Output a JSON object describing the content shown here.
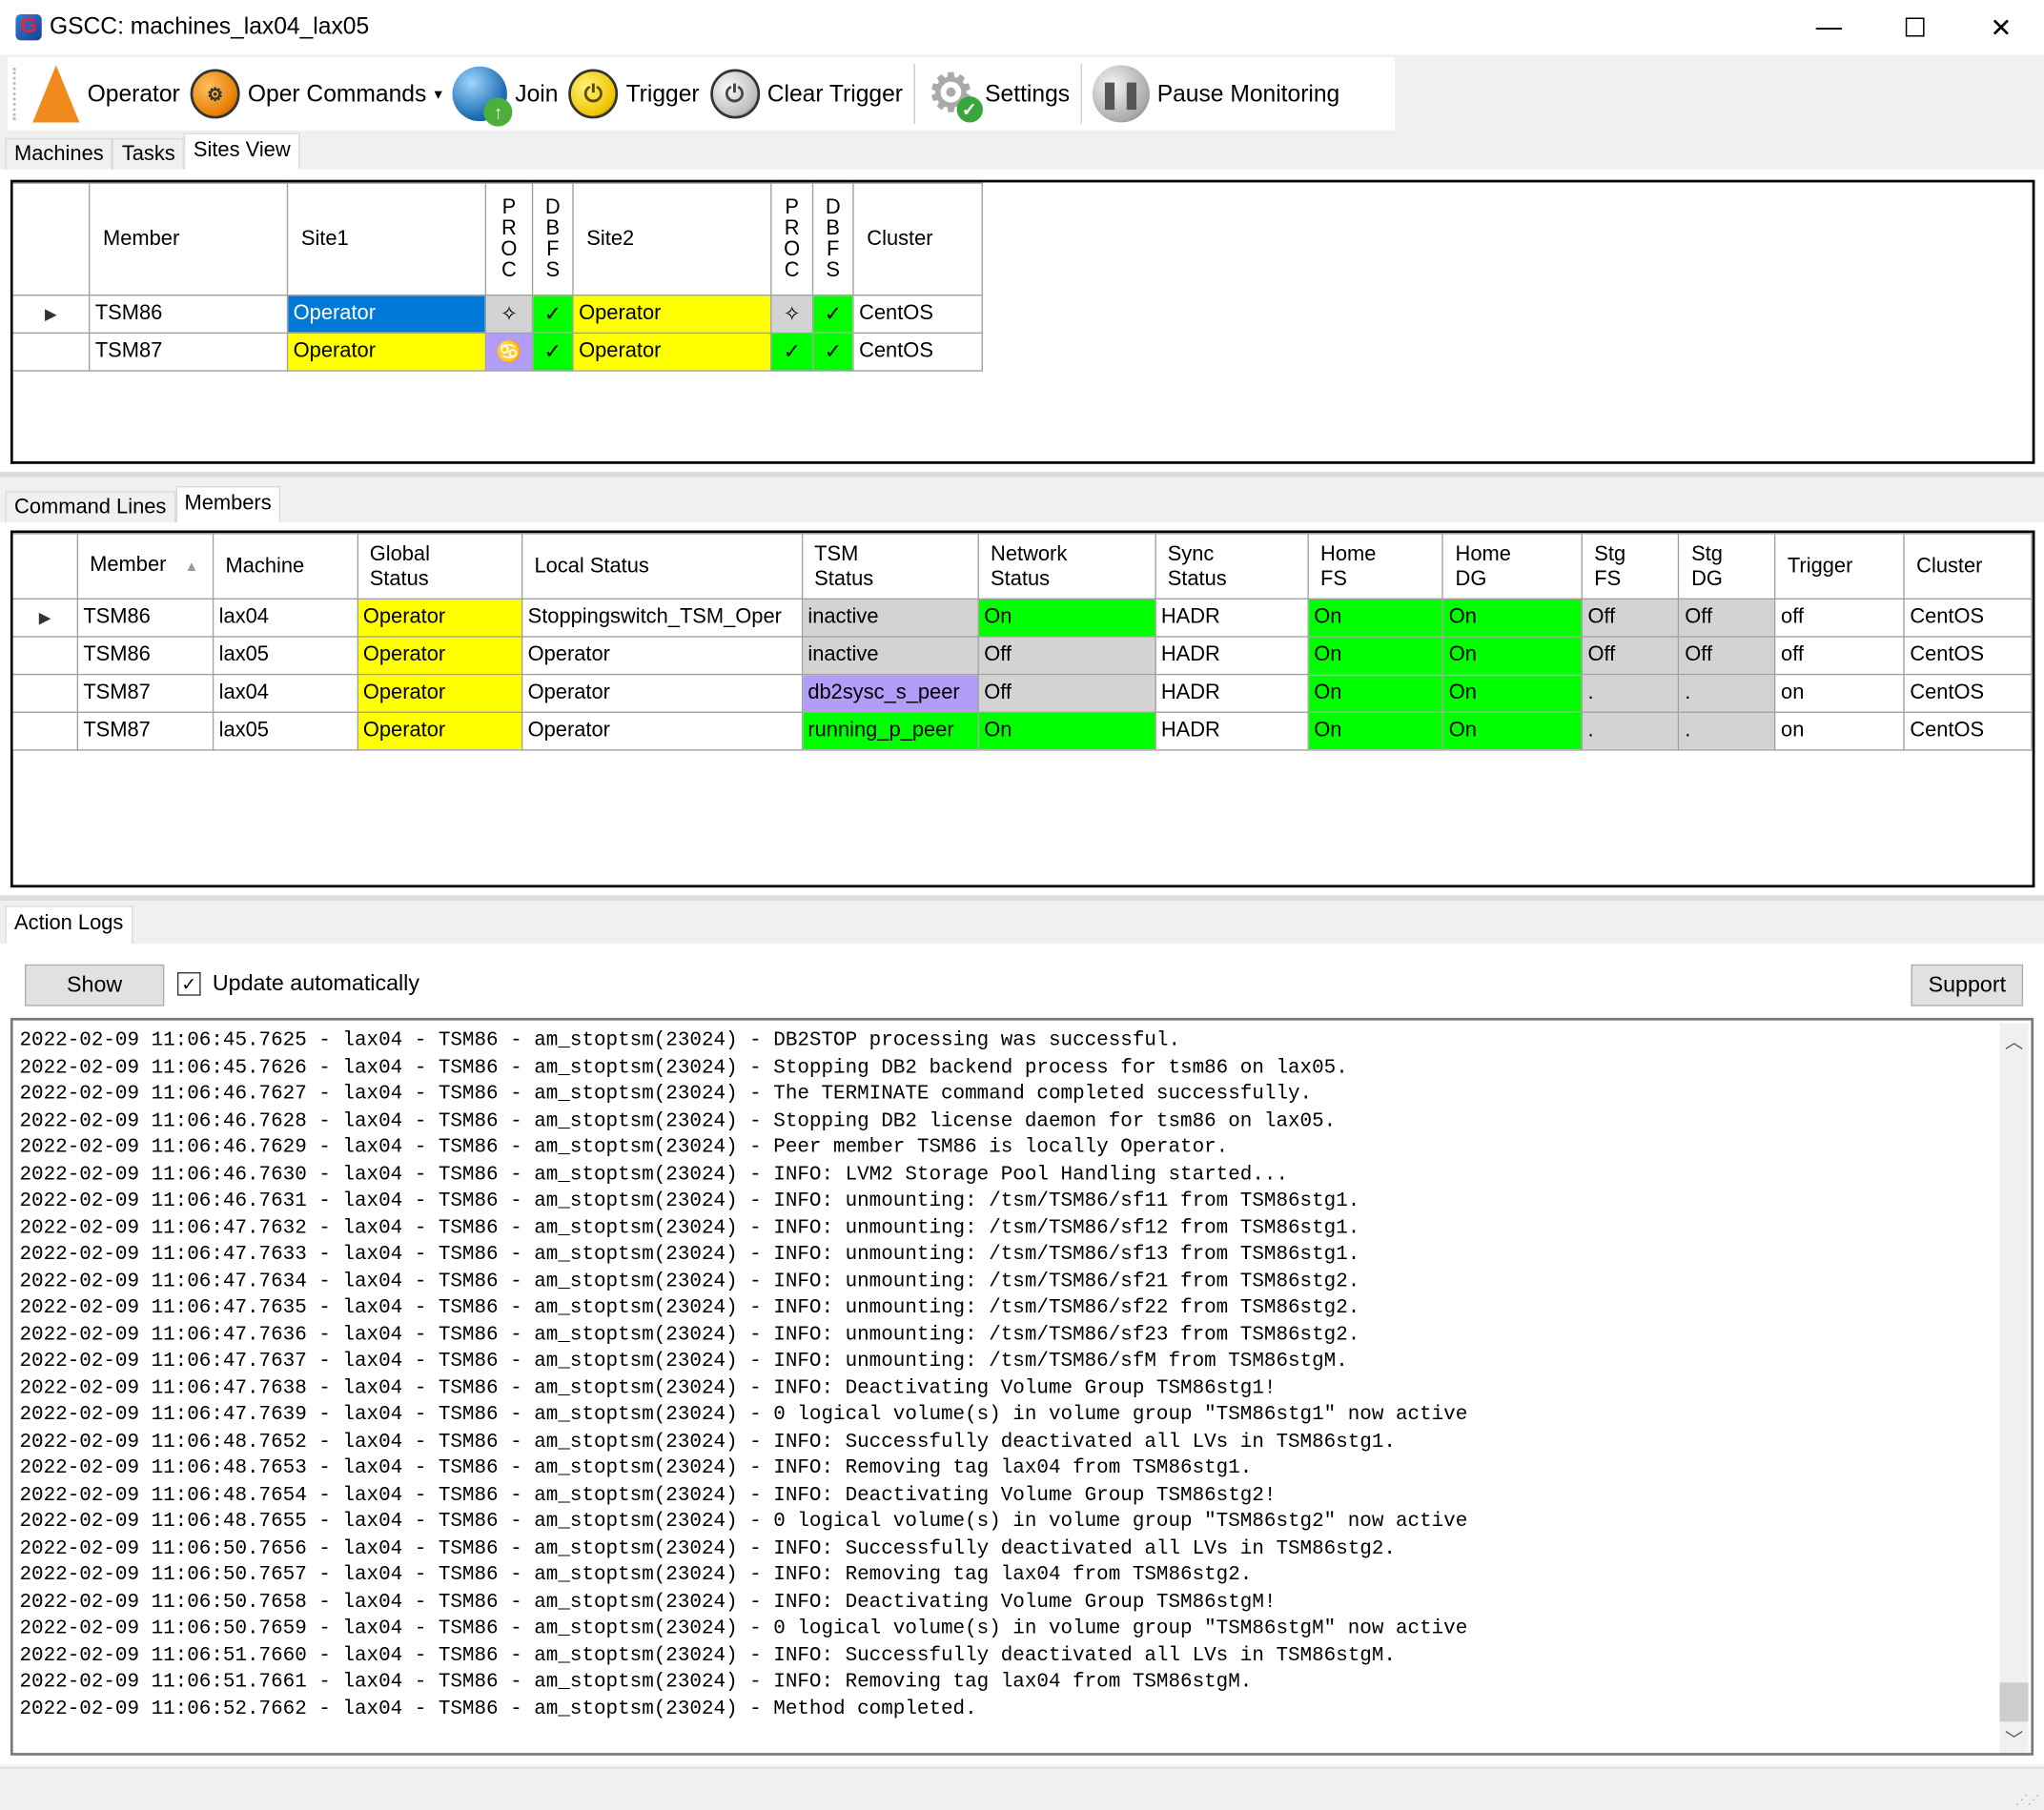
{
  "window": {
    "title": "GSCC: machines_lax04_lax05",
    "app_icon_glyph": "G",
    "controls": {
      "minimize": "—",
      "maximize": "☐",
      "close": "✕"
    }
  },
  "toolbar": {
    "items": [
      {
        "label": "Operator",
        "icon": "traffic-cone-icon"
      },
      {
        "label": "Oper Commands",
        "icon": "gears-icon",
        "has_dropdown": true,
        "dropdown_glyph": "▾",
        "glyph": "⚙"
      },
      {
        "label": "Join",
        "icon": "globe-icon"
      },
      {
        "label": "Trigger",
        "icon": "power-icon",
        "glyph": "⏻"
      },
      {
        "label": "Clear Trigger",
        "icon": "clear-power-icon",
        "glyph": "⏻"
      },
      {
        "label": "Settings",
        "icon": "settings-gear-icon",
        "glyph": "⚙"
      },
      {
        "label": "Pause Monitoring",
        "icon": "pause-icon",
        "glyph": "❚❚"
      }
    ]
  },
  "top_tabs": [
    {
      "label": "Machines",
      "active": false
    },
    {
      "label": "Tasks",
      "active": false
    },
    {
      "label": "Sites View",
      "active": true
    }
  ],
  "sites_table": {
    "columns": [
      "",
      "Member",
      "Site1",
      "PROC",
      "DBFS",
      "Site2",
      "PROC",
      "DBFS",
      "Cluster"
    ],
    "rows": [
      {
        "selected_marker": "▶",
        "member": "TSM86",
        "site1": {
          "text": "Operator",
          "color": "#0078d7"
        },
        "proc1": {
          "glyph": "✧",
          "color": "#d3d3d3"
        },
        "dbfs1": {
          "glyph": "✓",
          "color": "#00ff00"
        },
        "site2": {
          "text": "Operator",
          "color": "#ffff00"
        },
        "proc2": {
          "glyph": "✧",
          "color": "#d3d3d3"
        },
        "dbfs2": {
          "glyph": "✓",
          "color": "#00ff00"
        },
        "cluster": "CentOS"
      },
      {
        "selected_marker": "",
        "member": "TSM87",
        "site1": {
          "text": "Operator",
          "color": "#ffff00"
        },
        "proc1": {
          "glyph": "♋",
          "color": "#b19cf7"
        },
        "dbfs1": {
          "glyph": "✓",
          "color": "#00ff00"
        },
        "site2": {
          "text": "Operator",
          "color": "#ffff00"
        },
        "proc2": {
          "glyph": "✓",
          "color": "#00ff00"
        },
        "dbfs2": {
          "glyph": "✓",
          "color": "#00ff00"
        },
        "cluster": "CentOS"
      }
    ]
  },
  "mid_tabs": [
    {
      "label": "Command Lines",
      "active": false
    },
    {
      "label": "Members",
      "active": true
    }
  ],
  "members_table": {
    "columns": [
      [
        "Member"
      ],
      [
        "Machine"
      ],
      [
        "Global",
        "Status"
      ],
      [
        "Local Status"
      ],
      [
        "TSM",
        "Status"
      ],
      [
        "Network",
        "Status"
      ],
      [
        "Sync",
        "Status"
      ],
      [
        "Home",
        "FS"
      ],
      [
        "Home",
        "DG"
      ],
      [
        "Stg",
        "FS"
      ],
      [
        "Stg",
        "DG"
      ],
      [
        "Trigger"
      ],
      [
        "Cluster"
      ]
    ],
    "sort_indicator": "▲",
    "rows": [
      {
        "marker": "▶",
        "cells": [
          {
            "t": "TSM86",
            "c": "#ffffff"
          },
          {
            "t": "lax04",
            "c": "#ffffff"
          },
          {
            "t": "Operator",
            "c": "#ffff00"
          },
          {
            "t": "Stoppingswitch_TSM_Oper",
            "c": "#ffffff"
          },
          {
            "t": "inactive",
            "c": "#d3d3d3"
          },
          {
            "t": "On",
            "c": "#00ff00"
          },
          {
            "t": "HADR",
            "c": "#ffffff"
          },
          {
            "t": "On",
            "c": "#00ff00"
          },
          {
            "t": "On",
            "c": "#00ff00"
          },
          {
            "t": "Off",
            "c": "#d3d3d3"
          },
          {
            "t": "Off",
            "c": "#d3d3d3"
          },
          {
            "t": "off",
            "c": "#ffffff"
          },
          {
            "t": "CentOS",
            "c": "#ffffff"
          }
        ]
      },
      {
        "marker": "",
        "cells": [
          {
            "t": "TSM86",
            "c": "#ffffff"
          },
          {
            "t": "lax05",
            "c": "#ffffff"
          },
          {
            "t": "Operator",
            "c": "#ffff00"
          },
          {
            "t": "Operator",
            "c": "#ffffff"
          },
          {
            "t": "inactive",
            "c": "#d3d3d3"
          },
          {
            "t": "Off",
            "c": "#d3d3d3"
          },
          {
            "t": "HADR",
            "c": "#ffffff"
          },
          {
            "t": "On",
            "c": "#00ff00"
          },
          {
            "t": "On",
            "c": "#00ff00"
          },
          {
            "t": "Off",
            "c": "#d3d3d3"
          },
          {
            "t": "Off",
            "c": "#d3d3d3"
          },
          {
            "t": "off",
            "c": "#ffffff"
          },
          {
            "t": "CentOS",
            "c": "#ffffff"
          }
        ]
      },
      {
        "marker": "",
        "cells": [
          {
            "t": "TSM87",
            "c": "#ffffff"
          },
          {
            "t": "lax04",
            "c": "#ffffff"
          },
          {
            "t": "Operator",
            "c": "#ffff00"
          },
          {
            "t": "Operator",
            "c": "#ffffff"
          },
          {
            "t": "db2sysc_s_peer",
            "c": "#b19cf7"
          },
          {
            "t": "Off",
            "c": "#d3d3d3"
          },
          {
            "t": "HADR",
            "c": "#ffffff"
          },
          {
            "t": "On",
            "c": "#00ff00"
          },
          {
            "t": "On",
            "c": "#00ff00"
          },
          {
            "t": ".",
            "c": "#d3d3d3"
          },
          {
            "t": ".",
            "c": "#d3d3d3"
          },
          {
            "t": "on",
            "c": "#ffffff"
          },
          {
            "t": "CentOS",
            "c": "#ffffff"
          }
        ]
      },
      {
        "marker": "",
        "cells": [
          {
            "t": "TSM87",
            "c": "#ffffff"
          },
          {
            "t": "lax05",
            "c": "#ffffff"
          },
          {
            "t": "Operator",
            "c": "#ffff00"
          },
          {
            "t": "Operator",
            "c": "#ffffff"
          },
          {
            "t": "running_p_peer",
            "c": "#00ff00"
          },
          {
            "t": "On",
            "c": "#00ff00"
          },
          {
            "t": "HADR",
            "c": "#ffffff"
          },
          {
            "t": "On",
            "c": "#00ff00"
          },
          {
            "t": "On",
            "c": "#00ff00"
          },
          {
            "t": ".",
            "c": "#d3d3d3"
          },
          {
            "t": ".",
            "c": "#d3d3d3"
          },
          {
            "t": "on",
            "c": "#ffffff"
          },
          {
            "t": "CentOS",
            "c": "#ffffff"
          }
        ]
      }
    ]
  },
  "action_logs": {
    "tab_label": "Action Logs",
    "show_button": "Show",
    "update_auto_label": "Update automatically",
    "update_auto_checked": true,
    "support_button": "Support",
    "scroll_up_glyph": "︿",
    "scroll_down_glyph": "﹀",
    "lines": [
      "2022-02-09 11:06:45.7625 - lax04 - TSM86 - am_stoptsm(23024) - DB2STOP processing was successful.",
      "2022-02-09 11:06:45.7626 - lax04 - TSM86 - am_stoptsm(23024) - Stopping DB2 backend process for tsm86 on lax05.",
      "2022-02-09 11:06:46.7627 - lax04 - TSM86 - am_stoptsm(23024) - The TERMINATE command completed successfully.",
      "2022-02-09 11:06:46.7628 - lax04 - TSM86 - am_stoptsm(23024) - Stopping DB2 license daemon for tsm86 on lax05.",
      "2022-02-09 11:06:46.7629 - lax04 - TSM86 - am_stoptsm(23024) - Peer member TSM86 is locally Operator.",
      "2022-02-09 11:06:46.7630 - lax04 - TSM86 - am_stoptsm(23024) - INFO: LVM2 Storage Pool Handling started...",
      "2022-02-09 11:06:46.7631 - lax04 - TSM86 - am_stoptsm(23024) - INFO: unmounting: /tsm/TSM86/sf11 from TSM86stg1.",
      "2022-02-09 11:06:47.7632 - lax04 - TSM86 - am_stoptsm(23024) - INFO: unmounting: /tsm/TSM86/sf12 from TSM86stg1.",
      "2022-02-09 11:06:47.7633 - lax04 - TSM86 - am_stoptsm(23024) - INFO: unmounting: /tsm/TSM86/sf13 from TSM86stg1.",
      "2022-02-09 11:06:47.7634 - lax04 - TSM86 - am_stoptsm(23024) - INFO: unmounting: /tsm/TSM86/sf21 from TSM86stg2.",
      "2022-02-09 11:06:47.7635 - lax04 - TSM86 - am_stoptsm(23024) - INFO: unmounting: /tsm/TSM86/sf22 from TSM86stg2.",
      "2022-02-09 11:06:47.7636 - lax04 - TSM86 - am_stoptsm(23024) - INFO: unmounting: /tsm/TSM86/sf23 from TSM86stg2.",
      "2022-02-09 11:06:47.7637 - lax04 - TSM86 - am_stoptsm(23024) - INFO: unmounting: /tsm/TSM86/sfM from TSM86stgM.",
      "2022-02-09 11:06:47.7638 - lax04 - TSM86 - am_stoptsm(23024) - INFO: Deactivating Volume Group TSM86stg1!",
      "2022-02-09 11:06:47.7639 - lax04 - TSM86 - am_stoptsm(23024) - 0 logical volume(s) in volume group \"TSM86stg1\" now active",
      "2022-02-09 11:06:48.7652 - lax04 - TSM86 - am_stoptsm(23024) - INFO: Successfully deactivated all LVs in TSM86stg1.",
      "2022-02-09 11:06:48.7653 - lax04 - TSM86 - am_stoptsm(23024) - INFO: Removing tag lax04 from TSM86stg1.",
      "2022-02-09 11:06:48.7654 - lax04 - TSM86 - am_stoptsm(23024) - INFO: Deactivating Volume Group TSM86stg2!",
      "2022-02-09 11:06:48.7655 - lax04 - TSM86 - am_stoptsm(23024) - 0 logical volume(s) in volume group \"TSM86stg2\" now active",
      "2022-02-09 11:06:50.7656 - lax04 - TSM86 - am_stoptsm(23024) - INFO: Successfully deactivated all LVs in TSM86stg2.",
      "2022-02-09 11:06:50.7657 - lax04 - TSM86 - am_stoptsm(23024) - INFO: Removing tag lax04 from TSM86stg2.",
      "2022-02-09 11:06:50.7658 - lax04 - TSM86 - am_stoptsm(23024) - INFO: Deactivating Volume Group TSM86stgM!",
      "2022-02-09 11:06:50.7659 - lax04 - TSM86 - am_stoptsm(23024) - 0 logical volume(s) in volume group \"TSM86stgM\" now active",
      "2022-02-09 11:06:51.7660 - lax04 - TSM86 - am_stoptsm(23024) - INFO: Successfully deactivated all LVs in TSM86stgM.",
      "2022-02-09 11:06:51.7661 - lax04 - TSM86 - am_stoptsm(23024) - INFO: Removing tag lax04 from TSM86stgM.",
      "2022-02-09 11:06:52.7662 - lax04 - TSM86 - am_stoptsm(23024) - Method completed."
    ]
  }
}
